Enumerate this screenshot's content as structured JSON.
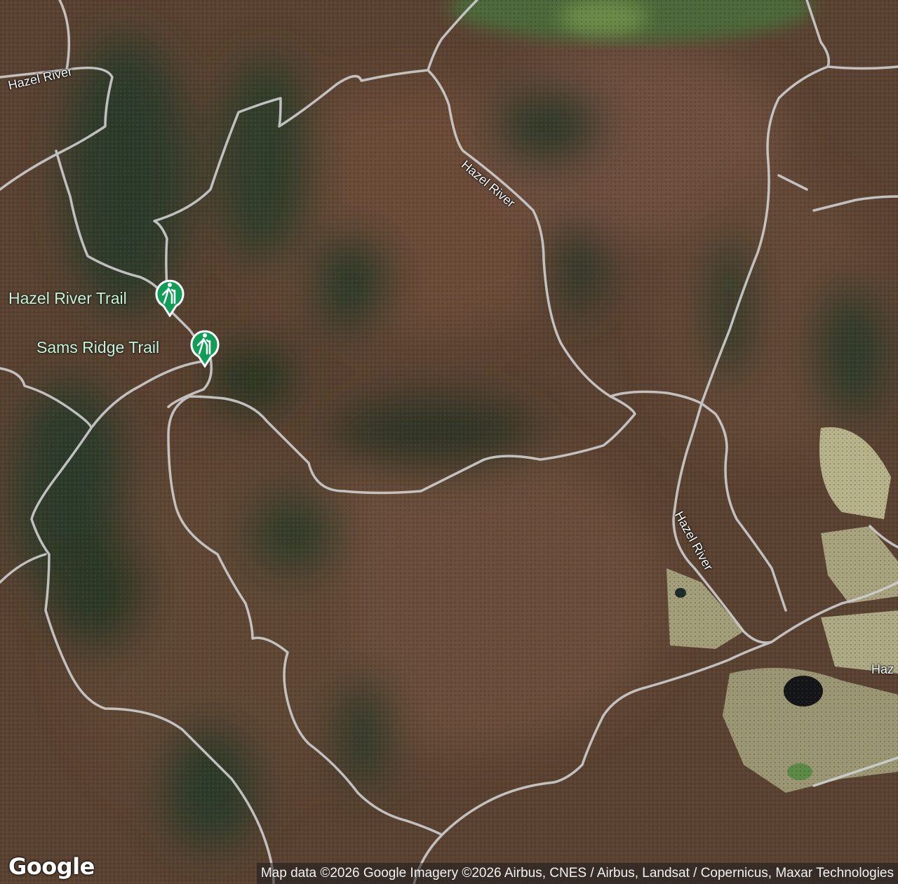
{
  "map": {
    "type": "satellite",
    "provider_logo": "Google",
    "attribution": "Map data ©2026 Google Imagery ©2026 Airbus, CNES / Airbus, Landsat / Copernicus, Maxar Technologies",
    "road_labels": [
      "Hazel River",
      "Hazel River",
      "Hazel River",
      "Haz"
    ],
    "pois": [
      {
        "name": "Hazel River Trail",
        "icon": "hiking-icon",
        "color": "#0f9d58"
      },
      {
        "name": "Sams Ridge Trail",
        "icon": "hiking-icon",
        "color": "#0f9d58"
      }
    ]
  }
}
